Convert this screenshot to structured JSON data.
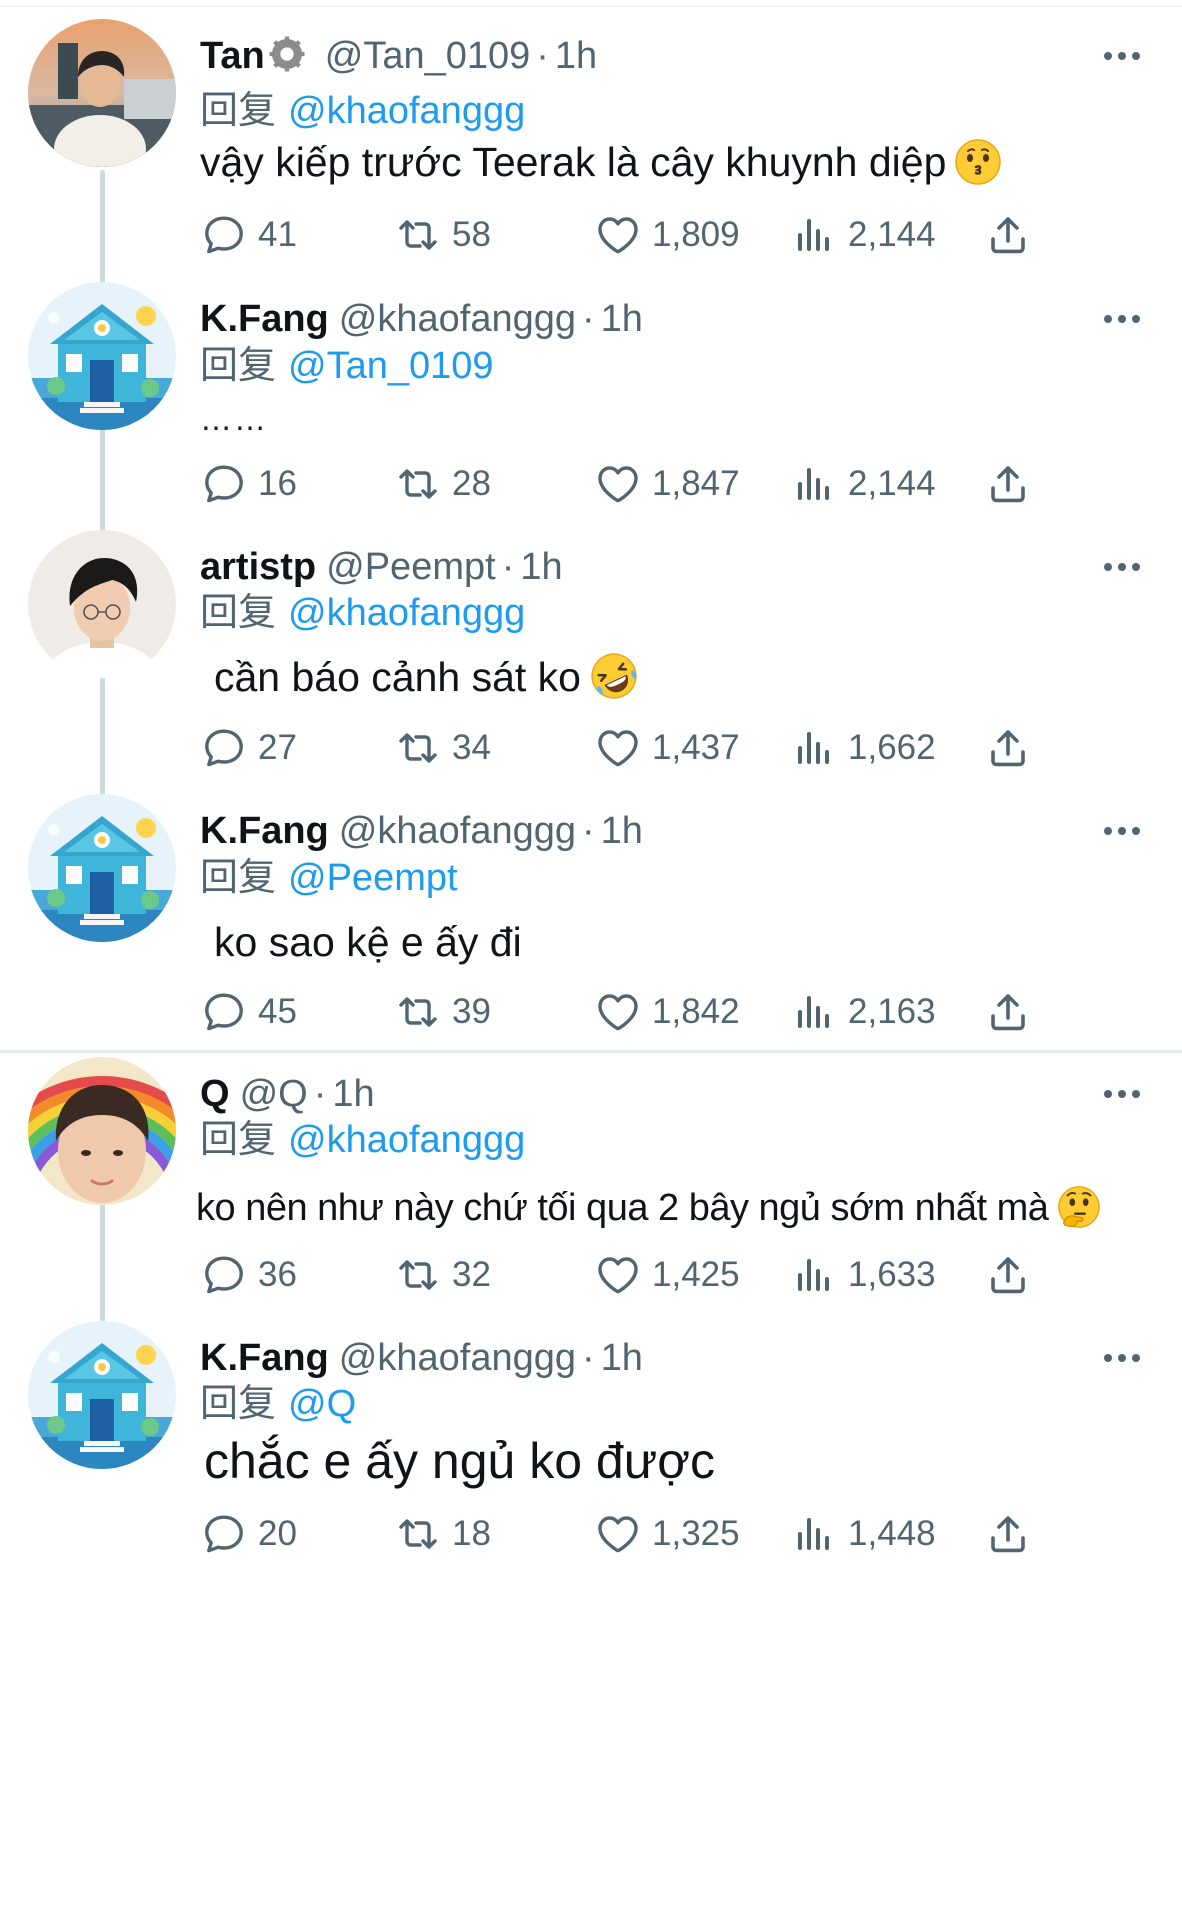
{
  "colors": {
    "accent": "#1d9bf0",
    "secondary_text": "#536471",
    "primary_text": "#0f1419",
    "thread_line": "#cfd9de"
  },
  "icons": {
    "reply": "comment-bubble-icon",
    "retweet": "retweet-arrows-icon",
    "like": "heart-icon",
    "views": "bar-chart-icon",
    "share": "upload-share-icon",
    "more": "more-dots-icon",
    "badge": "gear-badge-icon"
  },
  "tweets": [
    {
      "name": "Tan",
      "handle": "@Tan_0109",
      "sep": "·",
      "time": "1h",
      "replying_label": "回复",
      "replying_to": "@khaofanggg",
      "text": "vậy kiếp trước Teerak là cây khuynh diệp",
      "emoji": "kissing-face-emoji",
      "replies": "41",
      "retweets": "58",
      "likes": "1,809",
      "views": "2,144"
    },
    {
      "name": "K.Fang",
      "handle": "@khaofanggg",
      "sep": "·",
      "time": "1h",
      "replying_label": "回复",
      "replying_to": "@Tan_0109",
      "text": "……",
      "replies": "16",
      "retweets": "28",
      "likes": "1,847",
      "views": "2,144"
    },
    {
      "name": "artistp",
      "handle": "@Peempt",
      "sep": "·",
      "time": "1h",
      "replying_label": "回复",
      "replying_to": "@khaofanggg",
      "text": "cần báo cảnh sát ko",
      "emoji": "rolling-laughing-face-emoji",
      "replies": "27",
      "retweets": "34",
      "likes": "1,437",
      "views": "1,662"
    },
    {
      "name": "K.Fang",
      "handle": "@khaofanggg",
      "sep": "·",
      "time": "1h",
      "replying_label": "回复",
      "replying_to": "@Peempt",
      "text": "ko sao kệ e ấy đi",
      "replies": "45",
      "retweets": "39",
      "likes": "1,842",
      "views": "2,163"
    },
    {
      "name": "Q",
      "handle": "@Q",
      "sep": "·",
      "time": "1h",
      "replying_label": "回复",
      "replying_to": "@khaofanggg",
      "text": "ko nên như này chứ tối qua 2 bây ngủ sớm nhất mà",
      "emoji": "thinking-face-emoji",
      "replies": "36",
      "retweets": "32",
      "likes": "1,425",
      "views": "1,633"
    },
    {
      "name": "K.Fang",
      "handle": "@khaofanggg",
      "sep": "·",
      "time": "1h",
      "replying_label": "回复",
      "replying_to": "@Q",
      "text": "chắc e ấy ngủ ko được",
      "replies": "20",
      "retweets": "18",
      "likes": "1,325",
      "views": "1,448"
    }
  ]
}
